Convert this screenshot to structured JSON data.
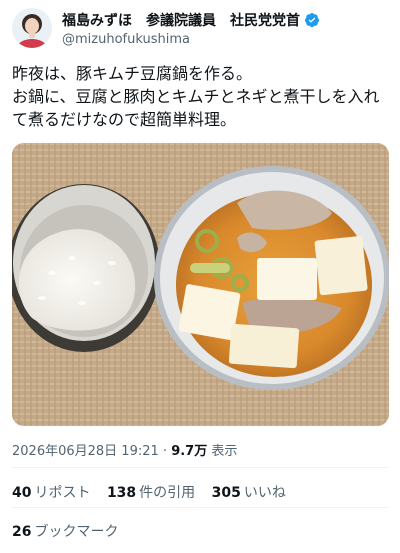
{
  "author": {
    "display_name": "福島みずほ　参議院議員　社民党党首",
    "handle": "@mizuhofukushima"
  },
  "tweet": {
    "text": "昨夜は、豚キムチ豆腐鍋を作る。\nお鍋に、豆腐と豚肉とキムチとネギと煮干しを入れて煮るだけなので超簡単料理。"
  },
  "meta": {
    "timestamp": "2026年06月28日 19:21",
    "separator": "·",
    "views_count": "9.7万",
    "views_label": "表示"
  },
  "stats": {
    "reposts_count": "40",
    "reposts_label": "リポスト",
    "quotes_count": "138",
    "quotes_label": "件の引用",
    "likes_count": "305",
    "likes_label": "いいね",
    "bookmarks_count": "26",
    "bookmarks_label": "ブックマーク"
  },
  "colors": {
    "verified_badge": "#1d9bf0",
    "secondary_text": "#536471"
  },
  "icons": {
    "verified": "verified-badge-icon"
  }
}
